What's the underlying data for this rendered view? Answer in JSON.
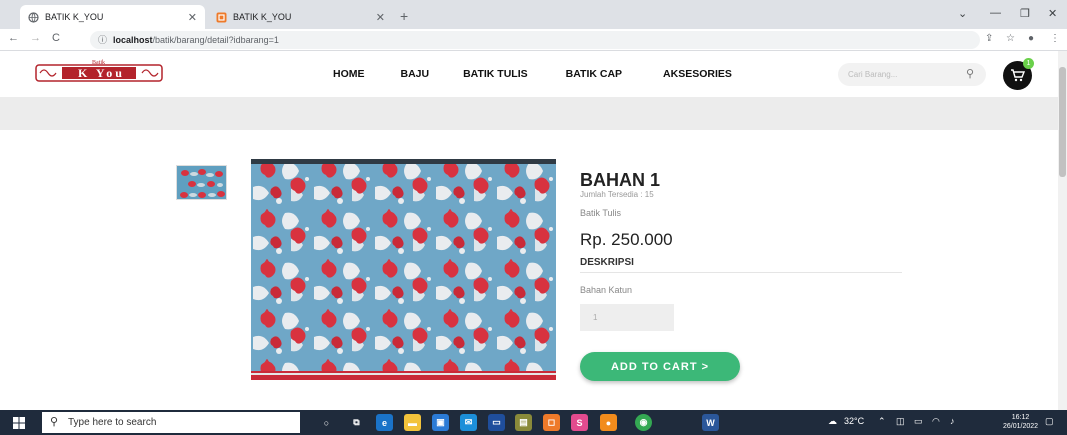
{
  "browser": {
    "tabs": [
      {
        "title": "BATIK K_YOU",
        "icon": "globe-icon"
      },
      {
        "title": "BATIK K_YOU",
        "icon": "codeigniter-icon"
      }
    ],
    "url_host": "localhost",
    "url_path": "/batik/barang/detail?idbarang=1"
  },
  "site": {
    "logo_text": "K You",
    "logo_small": "Batik",
    "menu": [
      "HOME",
      "BAJU",
      "BATIK TULIS",
      "BATIK CAP",
      "AKSESORIES"
    ],
    "search_placeholder": "Cari Barang...",
    "cart_count": "1"
  },
  "product": {
    "name": "BAHAN 1",
    "stock": "Jumlah Tersedia : 15",
    "category": "Batik Tulis",
    "price": "Rp. 250.000",
    "description_label": "DESKRIPSI",
    "description": "Bahan Katun",
    "quantity": "1",
    "add_to_cart": "ADD TO CART  >"
  },
  "taskbar": {
    "search_placeholder": "Type here to search",
    "weather": "32°C",
    "time": "16:12",
    "date": "26/01/2022"
  },
  "colors": {
    "accent_green": "#3cb878",
    "badge_green": "#6ad04a",
    "batik_blue": "#5f9fc0",
    "batik_red": "#d8323f"
  }
}
